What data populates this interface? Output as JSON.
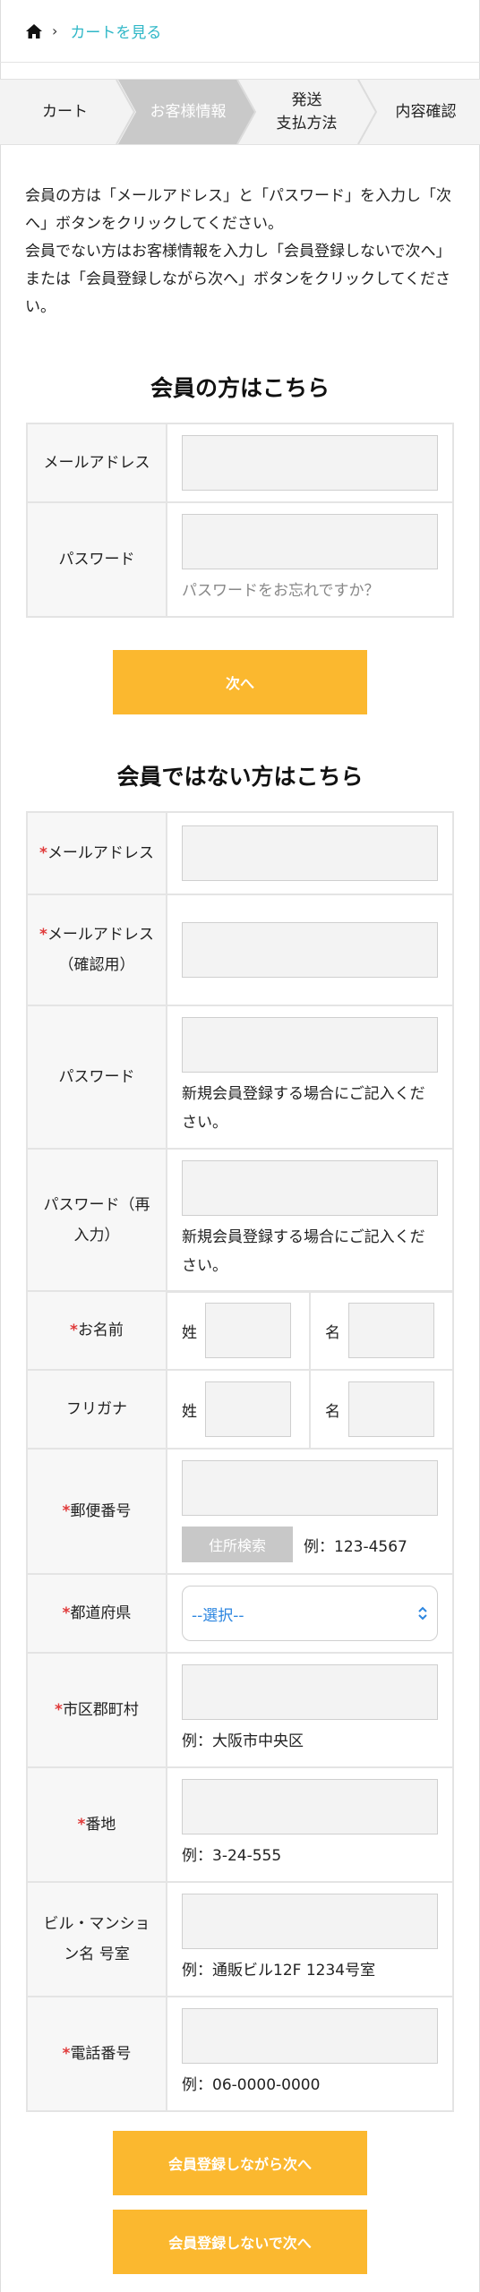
{
  "breadcrumb": {
    "home_icon": "home-icon",
    "link": "カートを見る"
  },
  "steps": [
    {
      "label": "カート",
      "active": false
    },
    {
      "label": "お客様情報",
      "active": true
    },
    {
      "label": "発送\n支払方法",
      "active": false
    },
    {
      "label": "内容確認",
      "active": false
    }
  ],
  "intro": "会員の方は「メールアドレス」と「パスワード」を入力し「次へ」ボタンをクリックしてください。\n会員でない方はお客様情報を入力し「会員登録しないで次へ」または「会員登録しながら次へ」ボタンをクリックしてください。",
  "member": {
    "heading": "会員の方はこちら",
    "email_label": "メールアドレス",
    "password_label": "パスワード",
    "forgot_link": "パスワードをお忘れですか？",
    "next_button": "次へ"
  },
  "guest": {
    "heading": "会員ではない方はこちら",
    "required_mark": "*",
    "email_label": "メールアドレス",
    "email_confirm_label": "メールアドレス",
    "email_confirm_sub": "（確認用）",
    "password_label": "パスワード",
    "password_hint": "新規会員登録する場合にご記入ください。",
    "password_confirm_label": "パスワード（再入力）",
    "password_confirm_hint": "新規会員登録する場合にご記入ください。",
    "name_label": "お名前",
    "kana_label": "フリガナ",
    "last_prefix": "姓",
    "first_prefix": "名",
    "zip_label": "郵便番号",
    "zip_search_button": "住所検索",
    "zip_example": "例：123-4567",
    "pref_label": "都道府県",
    "pref_selected": "--選択--",
    "city_label": "市区郡町村",
    "city_example": "例：大阪市中央区",
    "addr_label": "番地",
    "addr_example": "例：3-24-555",
    "bldg_label": "ビル・マンション名 号室",
    "bldg_example": "例：通販ビル12F 1234号室",
    "tel_label": "電話番号",
    "tel_example": "例：06-0000-0000",
    "register_next_button": "会員登録しながら次へ",
    "guest_next_button": "会員登録しないで次へ"
  },
  "colors": {
    "accent": "#fbb82f",
    "link": "#2fb7c7",
    "required": "#e03a3a",
    "select_text": "#2d86e0"
  }
}
